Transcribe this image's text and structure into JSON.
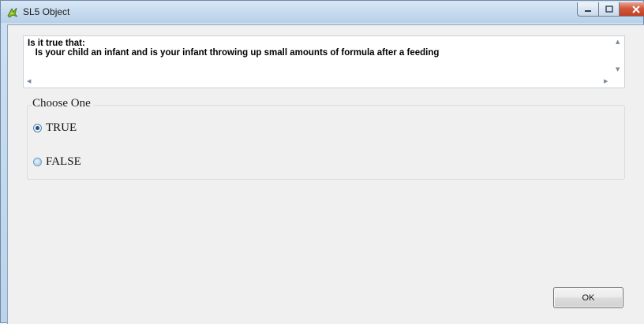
{
  "window": {
    "title": "SL5 Object",
    "controls": {
      "minimize_icon": "minimize-icon",
      "maximize_icon": "maximize-icon",
      "close_icon": "close-icon"
    }
  },
  "question": {
    "line1": "Is it true that:",
    "line2": "   Is your child an infant and is your infant throwing up small amounts of formula after a feeding"
  },
  "choices": {
    "group_label": "Choose One",
    "options": [
      {
        "label": "TRUE",
        "selected": true
      },
      {
        "label": "FALSE",
        "selected": false
      }
    ]
  },
  "footer": {
    "ok_label": "OK"
  },
  "colors": {
    "accent": "#1b4f86",
    "close_button": "#c23f22",
    "chrome": "#bcd3ea"
  }
}
